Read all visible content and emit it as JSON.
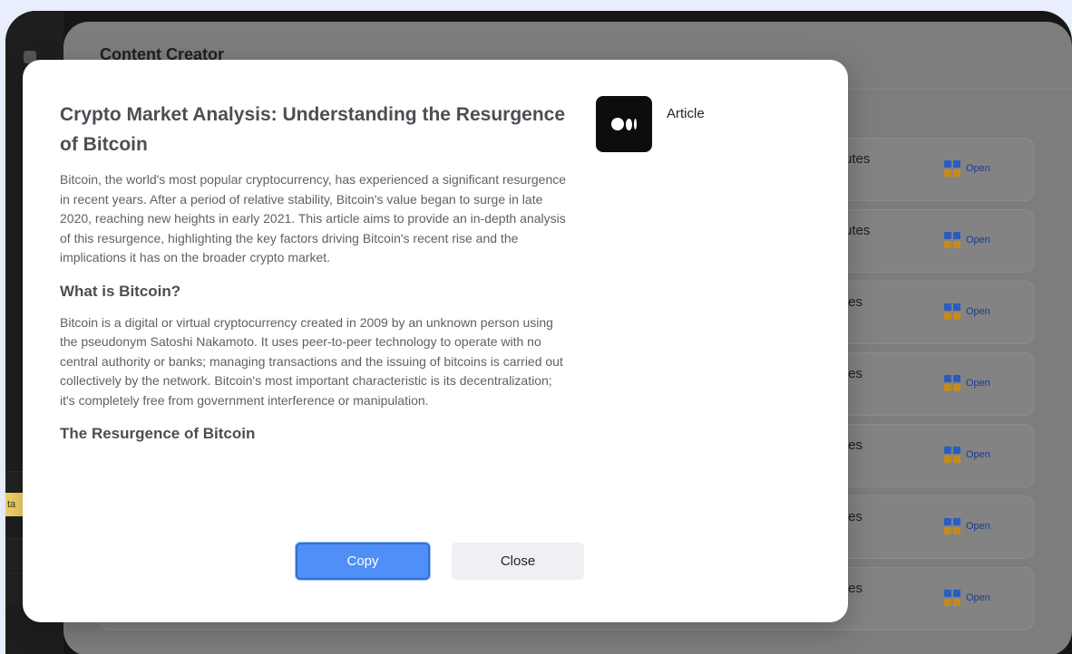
{
  "app": {
    "title": "Content Creator",
    "side_tag": "ta"
  },
  "rows": [
    {
      "minutes": "ninutes",
      "open_label": "Open"
    },
    {
      "minutes": "ninutes",
      "open_label": "Open"
    },
    {
      "minutes": "inutes",
      "open_label": "Open"
    },
    {
      "minutes": "inutes",
      "open_label": "Open"
    },
    {
      "minutes": "inutes",
      "open_label": "Open"
    },
    {
      "minutes": "inutes",
      "open_label": "Open"
    },
    {
      "minutes": "inutes",
      "open_label": "Open"
    }
  ],
  "modal": {
    "title": "Crypto Market Analysis: Understanding the Resurgence of Bitcoin",
    "intro": "Bitcoin, the world's most popular cryptocurrency, has experienced a significant resurgence in recent years. After a period of relative stability, Bitcoin's value began to surge in late 2020, reaching new heights in early 2021. This article aims to provide an in-depth analysis of this resurgence, highlighting the key factors driving Bitcoin's recent rise and the implications it has on the broader crypto market.",
    "section1_heading": "What is Bitcoin?",
    "section1_body": "Bitcoin is a digital or virtual cryptocurrency created in 2009 by an unknown person using the pseudonym Satoshi Nakamoto. It uses peer-to-peer technology to operate with no central authority or banks; managing transactions and the issuing of bitcoins is carried out collectively by the network. Bitcoin's most important characteristic is its decentralization; it's completely free from government interference or manipulation.",
    "section2_heading": "The Resurgence of Bitcoin",
    "source_label": "Article",
    "source_icon": "medium-logo-icon",
    "copy_label": "Copy",
    "close_label": "Close"
  },
  "colors": {
    "primary": "#4f8ff7",
    "secondary_button": "#eef0f3",
    "background": "#e8eefc"
  }
}
